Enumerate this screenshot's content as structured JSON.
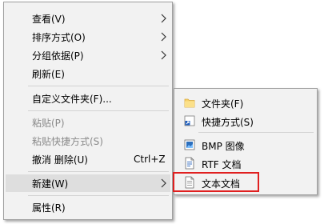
{
  "main_menu": {
    "items": [
      {
        "label": "查看(V)",
        "submenu": true
      },
      {
        "label": "排序方式(O)",
        "submenu": true
      },
      {
        "label": "分组依据(P)",
        "submenu": true
      },
      {
        "label": "刷新(E)"
      },
      {
        "label": "自定义文件夹(F)..."
      },
      {
        "label": "粘贴(P)",
        "disabled": true
      },
      {
        "label": "粘贴快捷方式(S)",
        "disabled": true
      },
      {
        "label": "撤消 删除(U)",
        "shortcut": "Ctrl+Z"
      },
      {
        "label": "新建(W)",
        "submenu": true,
        "highlighted": true
      },
      {
        "label": "属性(R)"
      }
    ]
  },
  "new_submenu": {
    "items": [
      {
        "label": "文件夹(F)",
        "icon": "folder-icon"
      },
      {
        "label": "快捷方式(S)",
        "icon": "shortcut-icon"
      },
      {
        "label": "BMP 图像",
        "icon": "bmp-image-icon"
      },
      {
        "label": "RTF 文档",
        "icon": "rtf-document-icon"
      },
      {
        "label": "文本文档",
        "icon": "text-document-icon",
        "annotated": true
      }
    ]
  },
  "colors": {
    "menu_background": "#f2f2f2",
    "highlight": "#dedede",
    "annotation_box": "#e02020",
    "disabled_text": "#8a8a8a"
  }
}
